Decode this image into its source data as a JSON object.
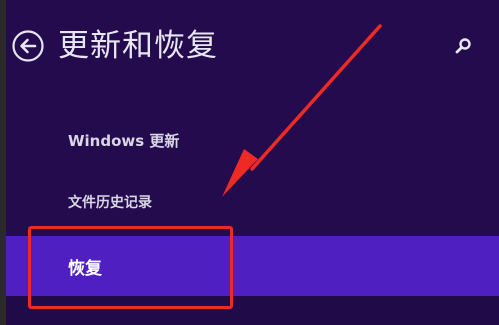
{
  "header": {
    "title": "更新和恢复",
    "back_icon": "back-arrow-circle-icon",
    "search_icon": "search-icon"
  },
  "nav": {
    "items": [
      {
        "label": "Windows 更新",
        "selected": false
      },
      {
        "label": "文件历史记录",
        "selected": false
      },
      {
        "label": "恢复",
        "selected": true
      }
    ]
  },
  "colors": {
    "background": "#230b4d",
    "selected_item": "#4f1fc2",
    "annotation": "#ee2a24"
  },
  "annotation": {
    "type": "arrow-and-box",
    "target": "恢复"
  }
}
